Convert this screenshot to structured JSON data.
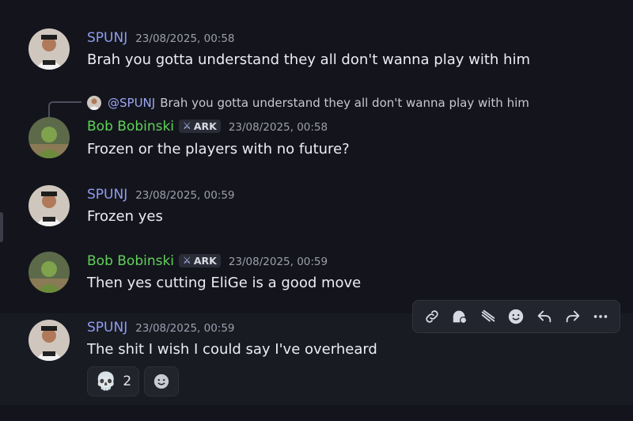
{
  "messages": [
    {
      "author": "SPUNJ",
      "timestamp": "23/08/2025, 00:58",
      "text": "Brah you gotta understand they all don't wanna play with him"
    },
    {
      "author": "Bob Bobinski",
      "tag": "ARK",
      "timestamp": "23/08/2025, 00:58",
      "text": "Frozen or the players with no future?",
      "reply": {
        "mention": "@SPUNJ",
        "text": "Brah you gotta understand they all don't wanna play with him"
      }
    },
    {
      "author": "SPUNJ",
      "timestamp": "23/08/2025, 00:59",
      "text": "Frozen yes"
    },
    {
      "author": "Bob Bobinski",
      "tag": "ARK",
      "timestamp": "23/08/2025, 00:59",
      "text": "Then yes cutting EliGe is a good move"
    },
    {
      "author": "SPUNJ",
      "timestamp": "23/08/2025, 00:59",
      "text": "The shit I wish I could say I've overheard",
      "reactions": [
        {
          "emoji": "skull",
          "count": "2"
        }
      ]
    }
  ],
  "toolbar": {
    "icons": [
      "link-icon",
      "thread-icon",
      "forward-icon",
      "emoji-icon",
      "reply-icon",
      "share-icon",
      "more-icon"
    ]
  },
  "colors": {
    "spunj": "#8f9cf0",
    "bob": "#5fd15a",
    "background": "#14151c"
  }
}
